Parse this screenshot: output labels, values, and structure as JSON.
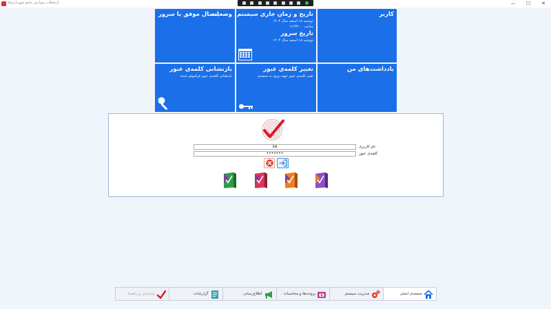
{
  "window": {
    "title": "ارتباطات  سوارس  جامع شهرداری‌ها",
    "minimize": "—",
    "maximize": "☐",
    "close": "✕"
  },
  "tiles": {
    "user": {
      "title": "کاربر"
    },
    "datetime": {
      "title": "تاریخ و زمان جاری سیستم",
      "date": "دوشنبه ۱۸ اسفند سال ۱۴۰۴",
      "time": "ساعت ۱۶:۴۳:۰۰",
      "server_title": "تاریخ سرور",
      "server_date": "دوشنبه ۱۸ اسفند سال ۱۴۰۴"
    },
    "status": {
      "title": "وضعیت",
      "text": "اتصال موفق با سرور"
    },
    "notes": {
      "title": "یادداشت‌های من"
    },
    "change_password": {
      "title": "تغییر کلمه‌ی عبور",
      "subtitle": "تغییر کلمه‌ی عبور جهت ورود به سیستم"
    },
    "reset_password": {
      "title": "بازنشانی کلمه‌ی عبور",
      "subtitle": "بازنشانی کلمه‌ی عبور فراموش شده"
    }
  },
  "login": {
    "username_label": "نام کاربری",
    "username_value": "sa",
    "password_label": "کلمه‌ی عبور",
    "password_value": "•••••••"
  },
  "taskbar": {
    "tabs": [
      {
        "label": "صفحه‌ی اصلی",
        "icon": "home-icon"
      },
      {
        "label": "مدیریت سیستم",
        "icon": "gears-icon"
      },
      {
        "label": "پرونده‌ها و محاسبات",
        "icon": "folder-money-icon"
      },
      {
        "label": "اطلاع‌رسانی",
        "icon": "megaphone-icon"
      },
      {
        "label": "گزارشات",
        "icon": "report-icon"
      },
      {
        "label": "پشتیبانی و راهنما",
        "icon": "support-icon"
      }
    ]
  },
  "colors": {
    "tile_blue": "#1b6fe8",
    "background": "#f0f4fb",
    "cancel_red": "#e0392b",
    "accent_blue": "#3b8fd8"
  }
}
